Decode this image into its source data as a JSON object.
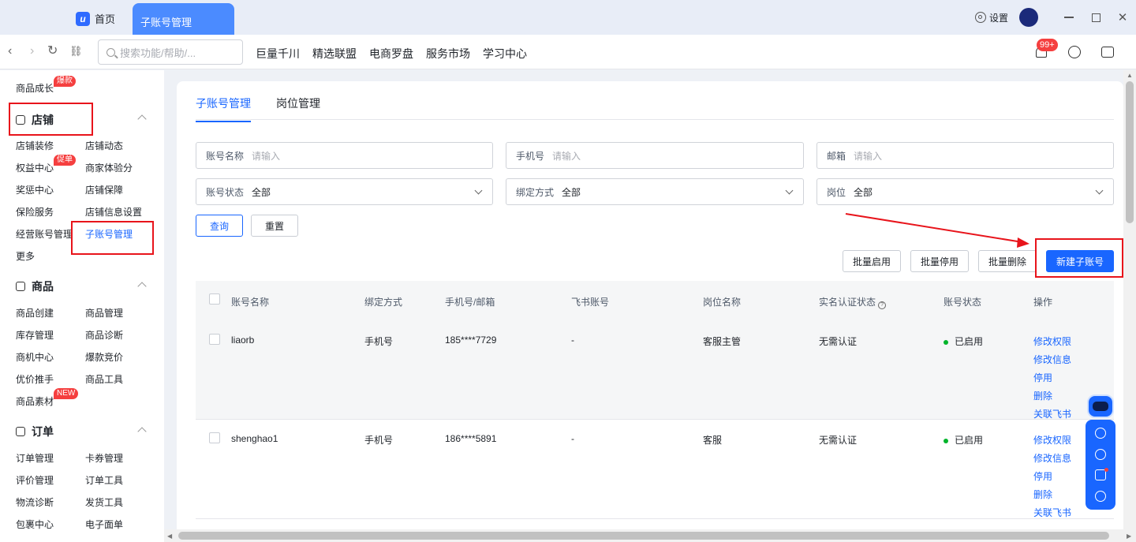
{
  "titlebar": {
    "logo_letter": "u",
    "home_tab": "首页",
    "active_tab": "子账号管理",
    "settings_label": "设置"
  },
  "navbar": {
    "search_placeholder": "搜索功能/帮助/...",
    "links": [
      "巨量千川",
      "精选联盟",
      "电商罗盘",
      "服务市场",
      "学习中心"
    ],
    "notification_badge": "99+"
  },
  "sidebar": {
    "top_item": "商品成长",
    "top_item_badge": "爆款",
    "groups": [
      {
        "title": "店铺",
        "items": [
          "店铺装修",
          "店铺动态",
          "权益中心",
          "商家体验分",
          "奖惩中心",
          "店铺保障",
          "保险服务",
          "店铺信息设置",
          "经营账号管理",
          "子账号管理",
          "更多"
        ],
        "badge": "促单"
      },
      {
        "title": "商品",
        "items": [
          "商品创建",
          "商品管理",
          "库存管理",
          "商品诊断",
          "商机中心",
          "爆款竞价",
          "优价推手",
          "商品工具",
          "商品素材"
        ],
        "badge": "NEW"
      },
      {
        "title": "订单",
        "items": [
          "订单管理",
          "卡券管理",
          "评价管理",
          "订单工具",
          "物流诊断",
          "发货工具",
          "包裹中心",
          "电子面单"
        ]
      }
    ]
  },
  "main": {
    "tabs": [
      "子账号管理",
      "岗位管理"
    ],
    "filters": {
      "account_name": {
        "label": "账号名称",
        "placeholder": "请输入"
      },
      "phone": {
        "label": "手机号",
        "placeholder": "请输入"
      },
      "email": {
        "label": "邮箱",
        "placeholder": "请输入"
      },
      "account_status": {
        "label": "账号状态",
        "value": "全部"
      },
      "bind_method": {
        "label": "绑定方式",
        "value": "全部"
      },
      "position": {
        "label": "岗位",
        "value": "全部"
      }
    },
    "query_button": "查询",
    "reset_button": "重置",
    "batch_enable": "批量启用",
    "batch_disable": "批量停用",
    "batch_delete": "批量删除",
    "new_account": "新建子账号",
    "table": {
      "headers": [
        "账号名称",
        "绑定方式",
        "手机号/邮箱",
        "飞书账号",
        "岗位名称",
        "实名认证状态",
        "账号状态",
        "操作"
      ],
      "info_icon": "?",
      "rows": [
        {
          "name": "liaorb",
          "bind": "手机号",
          "contact": "185****7729",
          "feishu": "-",
          "position": "客服主管",
          "verify": "无需认证",
          "status": "已启用",
          "ops": [
            "修改权限",
            "修改信息",
            "停用",
            "删除",
            "关联飞书"
          ]
        },
        {
          "name": "shenghao1",
          "bind": "手机号",
          "contact": "186****5891",
          "feishu": "-",
          "position": "客服",
          "verify": "无需认证",
          "status": "已启用",
          "ops": [
            "修改权限",
            "修改信息",
            "停用",
            "删除",
            "关联飞书"
          ]
        }
      ]
    }
  },
  "colors": {
    "accent": "#1966ff",
    "annotation_red": "#e8141b",
    "status_green": "#00b42a",
    "badge_red": "#f53f3f"
  }
}
